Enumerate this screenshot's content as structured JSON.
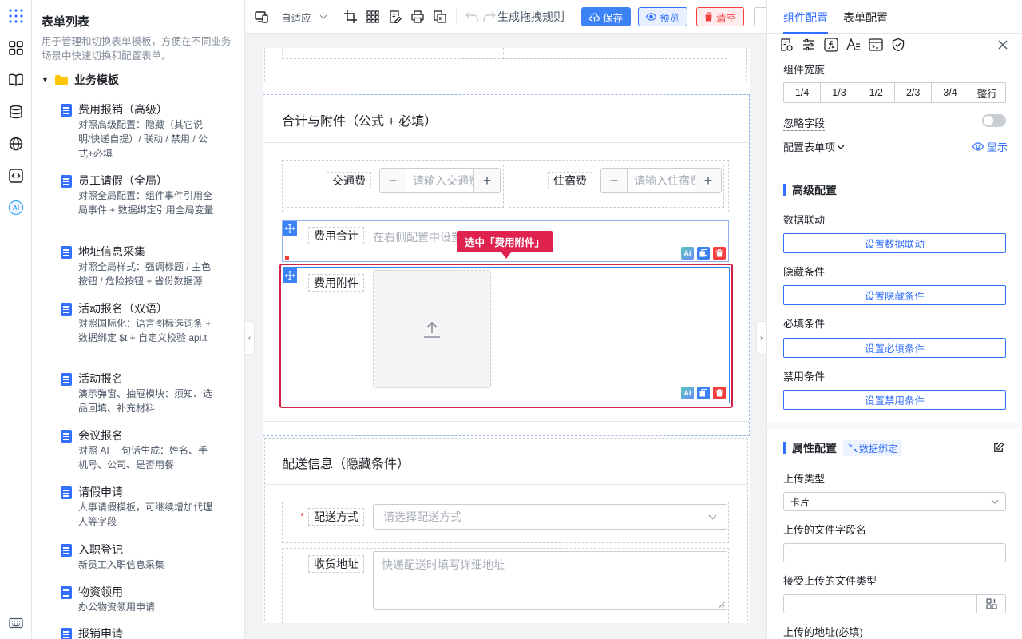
{
  "sidebar_list": {
    "title": "表单列表",
    "description": "用于管理和切换表单模板，方便在不同业务场景中快速切换和配置表单。",
    "group": "业务模板",
    "items": [
      {
        "name": "费用报销（高级）",
        "desc": "对照高级配置：隐藏（其它说明/快递自提）/ 联动 / 禁用 / 公式+必填"
      },
      {
        "name": "员工请假（全局）",
        "desc": "对照全局配置：组件事件引用全局事件 + 数据绑定引用全局变量"
      },
      {
        "name": "地址信息采集",
        "desc": "对照全局样式：强调标题 / 主色按钮 / 危险按钮 + 省份数据源"
      },
      {
        "name": "活动报名（双语）",
        "desc": "对照国际化：语言图标选词条 + 数据绑定 $t + 自定义校验 api.t"
      },
      {
        "name": "活动报名",
        "desc": "演示弹窗、抽屉模块：须知、选品回填、补充材料"
      },
      {
        "name": "会议报名",
        "desc": "对照 AI 一句话生成：姓名、手机号、公司、是否用餐"
      },
      {
        "name": "请假申请",
        "desc": "人事请假模板，可继续增加代理人等字段"
      },
      {
        "name": "入职登记",
        "desc": "新员工入职信息采集"
      },
      {
        "name": "物资领用",
        "desc": "办公物资领用申请"
      },
      {
        "name": "报销申请",
        "desc": ""
      }
    ]
  },
  "rail": {
    "ai_label": "AI"
  },
  "toolbar": {
    "layout_mode": "自适应",
    "gen_rules": "生成拖拽规则",
    "save": "保存",
    "preview": "预览",
    "clear": "清空"
  },
  "canvas": {
    "section1_title": "合计与附件（公式 + 必填）",
    "transport_label": "交通费",
    "transport_placeholder": "请输入交通费",
    "lodging_label": "住宿费",
    "lodging_placeholder": "请输入住宿费",
    "total_label": "费用合计",
    "total_hint": "在右侧配置中设置公式",
    "tooltip": "选中「费用附件」",
    "attachment_label": "费用附件",
    "section2_title": "配送信息（隐藏条件）",
    "delivery_label": "配送方式",
    "delivery_required_mark": "*",
    "delivery_placeholder": "请选择配送方式",
    "address_label": "收货地址",
    "address_placeholder": "快递配送时填写详细地址",
    "ai_badge": "Ai"
  },
  "right_panel": {
    "tabs": [
      "组件配置",
      "表单配置"
    ],
    "active_tab": 0,
    "width_label": "组件宽度",
    "width_options": [
      "1/4",
      "1/3",
      "1/2",
      "2/3",
      "3/4",
      "整行"
    ],
    "ignore_label": "忽略字段",
    "ignore_on": false,
    "form_items_label": "配置表单项",
    "show_label": "显示",
    "advanced_title": "高级配置",
    "linkage_label": "数据联动",
    "linkage_btn": "设置数据联动",
    "hidden_label": "隐藏条件",
    "hidden_btn": "设置隐藏条件",
    "required_label": "必填条件",
    "required_btn": "设置必填条件",
    "disabled_label": "禁用条件",
    "disabled_btn": "设置禁用条件",
    "props_title": "属性配置",
    "bind_tag": "数据绑定",
    "upload_type_label": "上传类型",
    "upload_type_value": "卡片",
    "field_name_label": "上传的文件字段名",
    "field_name_value": "",
    "accept_label": "接受上传的文件类型",
    "accept_value": "",
    "action_label": "上传的地址(必填)"
  },
  "colors": {
    "primary": "#3370ff",
    "danger": "#f53f3f",
    "selected_border": "#d4214a",
    "tooltip_bg": "#e0224e"
  }
}
